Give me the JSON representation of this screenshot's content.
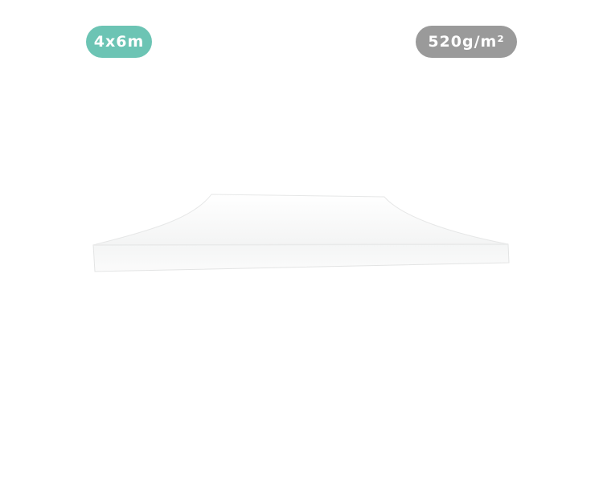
{
  "badges": {
    "size": {
      "label": "4x6m",
      "color": "#6cc4b4"
    },
    "weight": {
      "label": "520g/m²",
      "color": "#9a9a9a"
    }
  },
  "product": {
    "image": "canopy-roof-icon",
    "fabric_color": "#ffffff"
  }
}
